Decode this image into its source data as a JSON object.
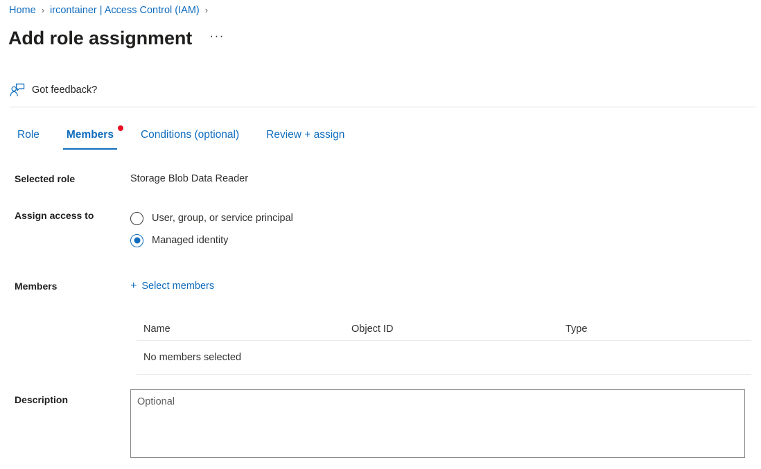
{
  "breadcrumb": {
    "items": [
      {
        "label": "Home"
      },
      {
        "label": "ircontainer | Access Control (IAM)"
      }
    ],
    "separator": "›"
  },
  "header": {
    "title": "Add role assignment",
    "more_menu": "···"
  },
  "commandbar": {
    "feedback_label": "Got feedback?",
    "feedback_icon": "person-feedback-icon"
  },
  "tabs": [
    {
      "label": "Role",
      "selected": false,
      "has_dot": false
    },
    {
      "label": "Members",
      "selected": true,
      "has_dot": true
    },
    {
      "label": "Conditions (optional)",
      "selected": false,
      "has_dot": false
    },
    {
      "label": "Review + assign",
      "selected": false,
      "has_dot": false
    }
  ],
  "form": {
    "selected_role": {
      "label": "Selected role",
      "value": "Storage Blob Data Reader"
    },
    "assign_access_to": {
      "label": "Assign access to",
      "options": [
        {
          "label": "User, group, or service principal",
          "checked": false
        },
        {
          "label": "Managed identity",
          "checked": true
        }
      ]
    },
    "members": {
      "label": "Members",
      "select_members_label": "Select members",
      "plus_icon": "+",
      "table": {
        "columns": [
          "Name",
          "Object ID",
          "Type"
        ],
        "empty_message": "No members selected",
        "rows": []
      }
    },
    "description": {
      "label": "Description",
      "placeholder": "Optional",
      "value": ""
    }
  },
  "colors": {
    "accent_blue": "#0f6cbd",
    "link_blue": "#0f6cbd",
    "dot_red": "#e81123",
    "text_primary": "#201f1e",
    "text_secondary": "#323130",
    "divider": "#e1dfdd",
    "border": "#8a8886"
  }
}
